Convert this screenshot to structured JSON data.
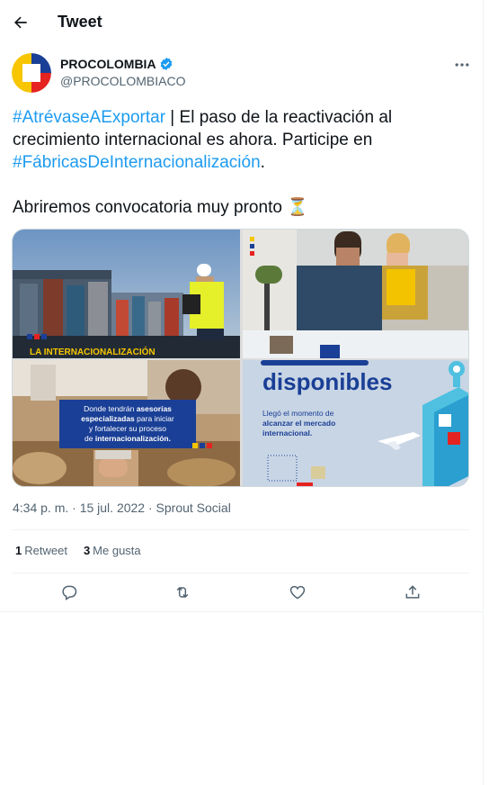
{
  "header": {
    "title": "Tweet"
  },
  "author": {
    "name": "PROCOLOMBIA",
    "handle": "@PROCOLOMBIACO"
  },
  "tweet": {
    "hashtag1": "#AtrévaseAExportar",
    "text1": " | El paso de la reactivación al crecimiento internacional es ahora. Participe en ",
    "hashtag2": "#FábricasDeInternacionalización",
    "text2": ".",
    "line2": "Abriremos convocatoria muy pronto ⏳"
  },
  "media": {
    "img1_caption": "LA INTERNACIONALIZACIÓN",
    "img3_line1a": "Donde tendrán ",
    "img3_line1b": "asesorías",
    "img3_line2a": "especializadas",
    "img3_line2b": " para iniciar",
    "img3_line3": "y fortalecer su proceso",
    "img3_line4a": "de ",
    "img3_line4b": "internacionalización.",
    "img4_heading": "disponibles",
    "img4_line1": "Llegó el momento de",
    "img4_line2": "alcanzar el mercado",
    "img4_line3": "internacional."
  },
  "meta": {
    "time": "4:34 p. m. · 15 jul. 2022 · Sprout Social"
  },
  "stats": {
    "retweets": "1",
    "retweets_label": "Retweet",
    "likes": "3",
    "likes_label": "Me gusta"
  },
  "colors": {
    "accent": "#1d9bf0",
    "text": "#0f1419",
    "muted": "#536471",
    "yellow": "#f7c600",
    "blue": "#1a3f96",
    "red": "#e52320"
  }
}
